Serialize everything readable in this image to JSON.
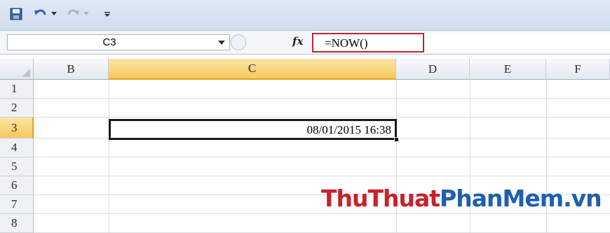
{
  "quick_access": {
    "icons": [
      "save-icon",
      "undo-icon",
      "dropdown-icon",
      "redo-icon",
      "dropdown-icon",
      "customize-icon"
    ]
  },
  "formula_bar": {
    "name_box_value": "C3",
    "fx_label": "fx",
    "formula_value": "=NOW()"
  },
  "sheet": {
    "columns": [
      "B",
      "C",
      "D",
      "E",
      "F"
    ],
    "rows": [
      "1",
      "2",
      "3",
      "4",
      "5",
      "6",
      "7",
      "8"
    ],
    "active_column": "C",
    "active_row": "3",
    "active_cell_value": "08/01/2015 16:38"
  },
  "watermark": {
    "part1": "ThuThuat",
    "part2": "PhanMem.vn"
  },
  "colors": {
    "formula_highlight": "#b8282e",
    "header_active": "#f6c95e",
    "watermark_red": "#c8222c",
    "watermark_blue": "#1f5fae"
  }
}
